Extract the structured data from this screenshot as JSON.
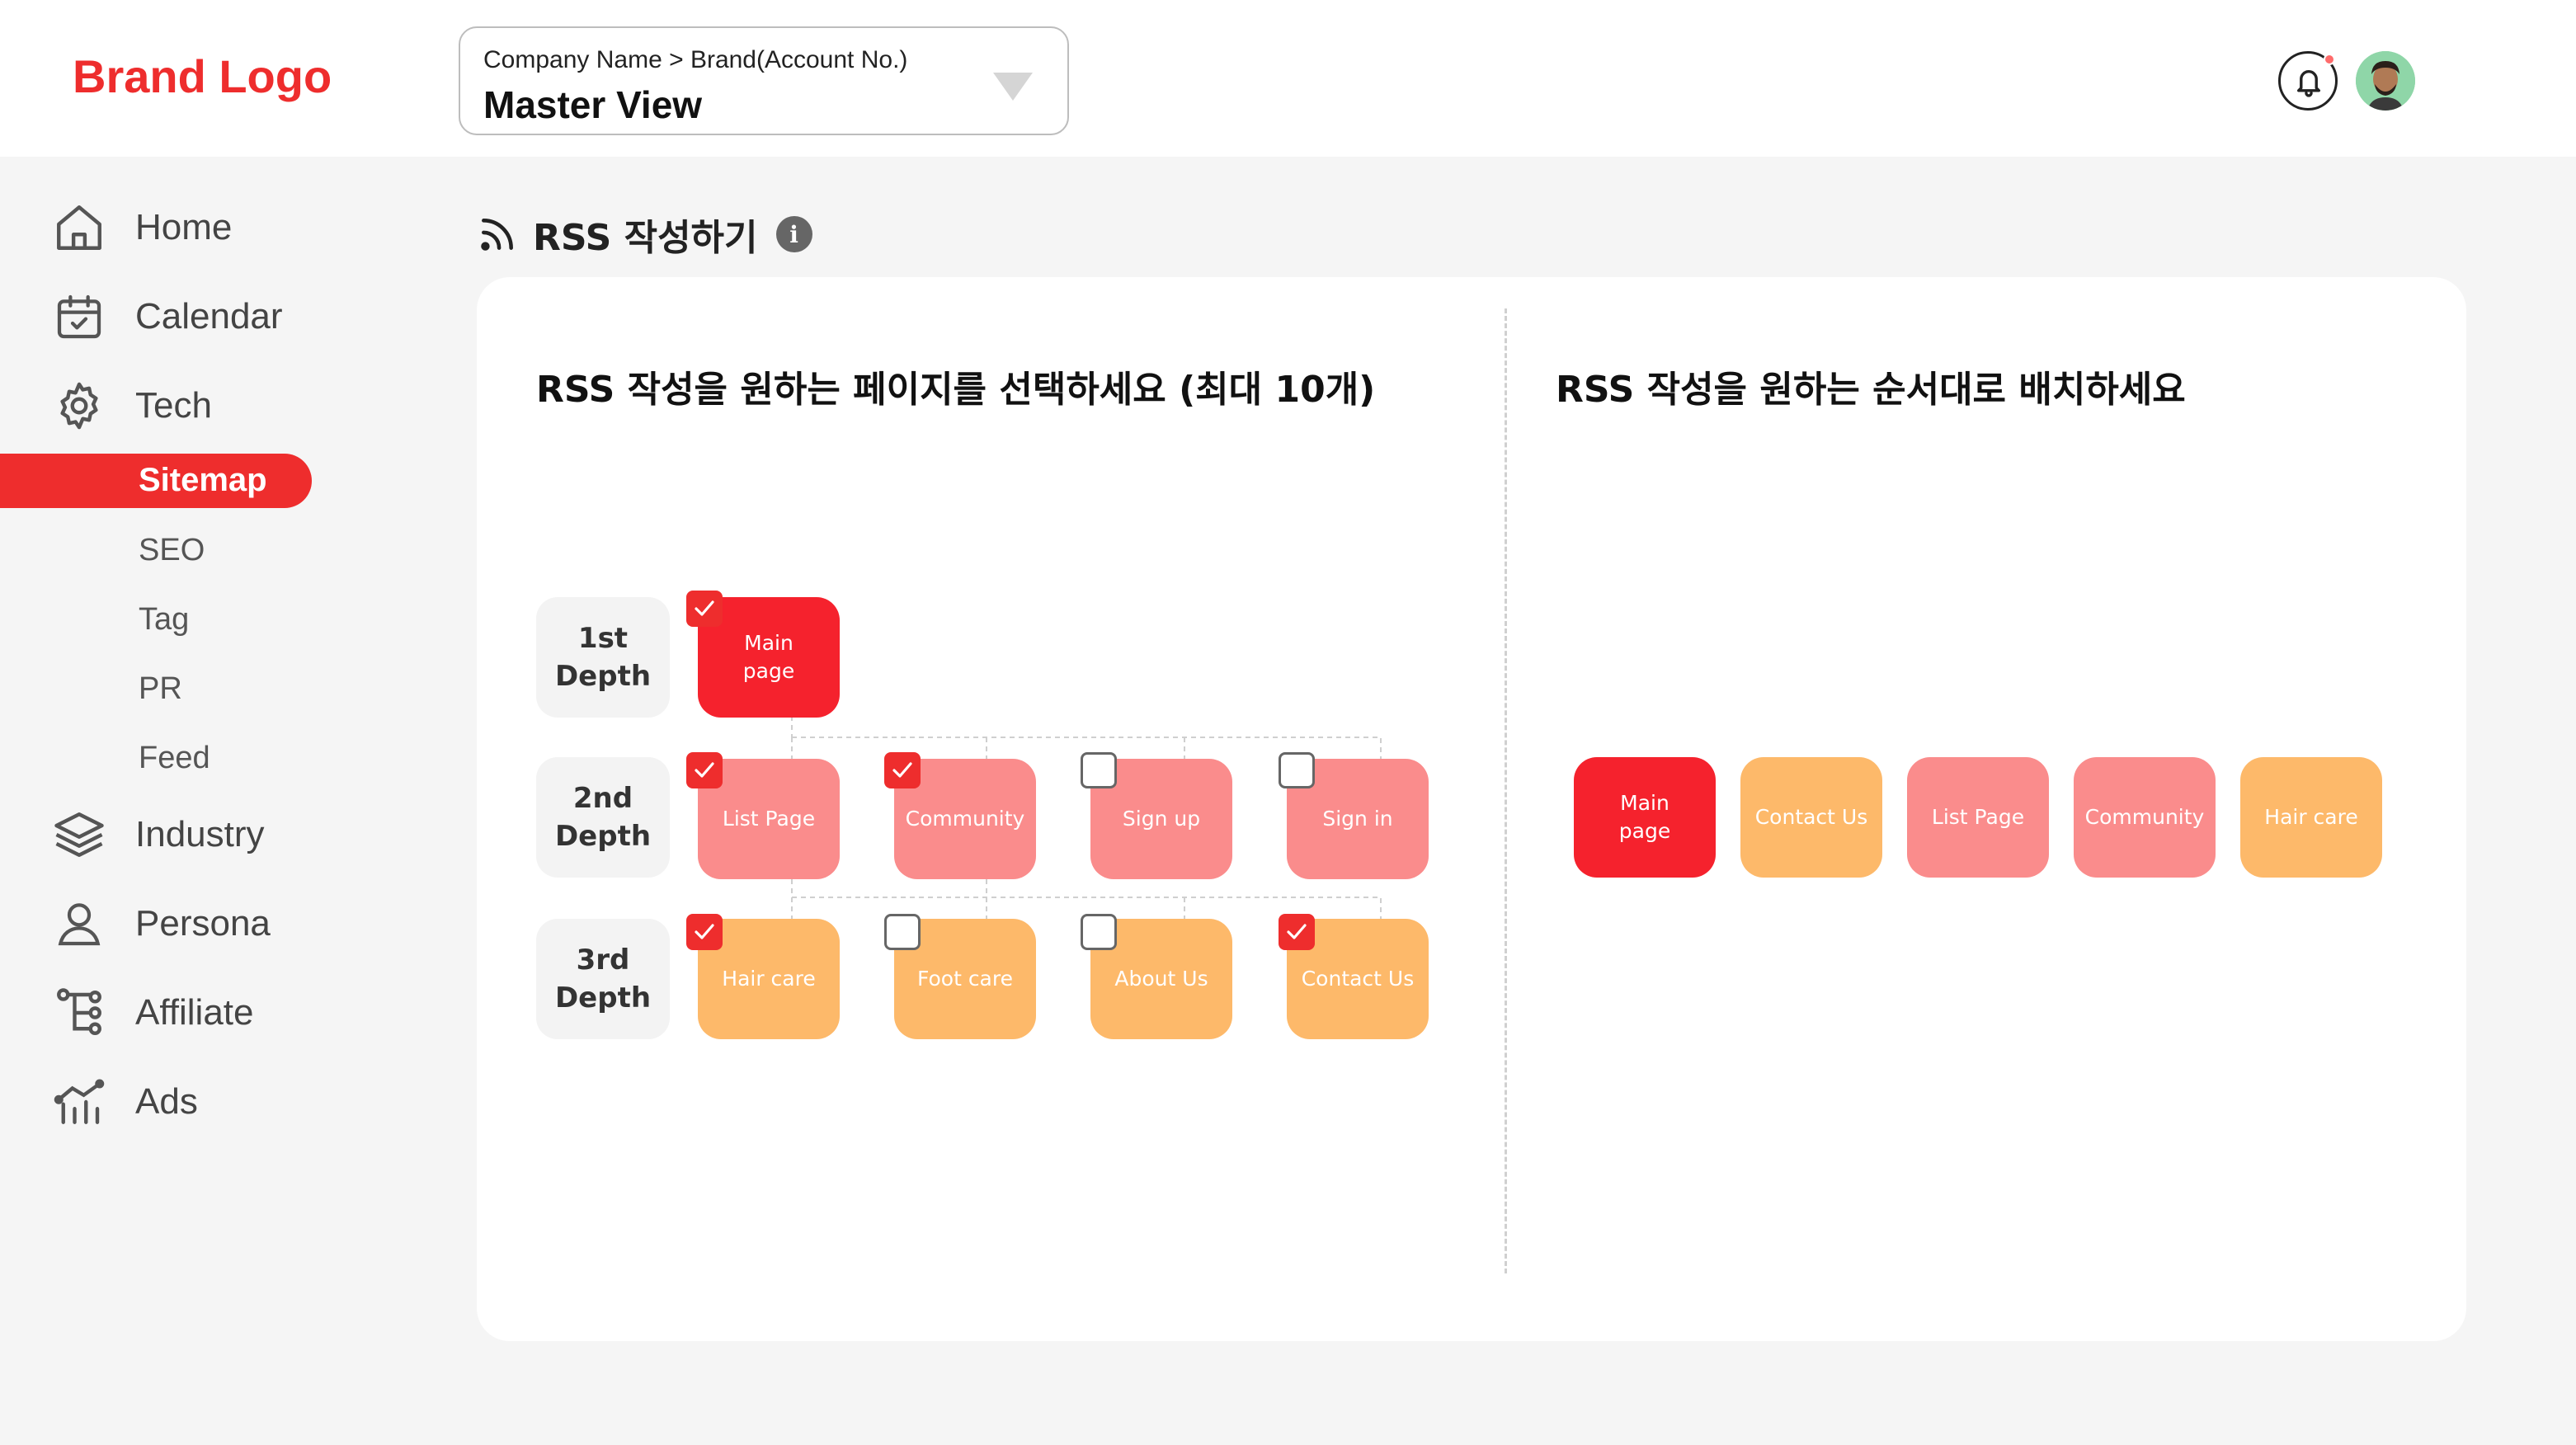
{
  "header": {
    "brand": "Brand Logo",
    "account_path": "Company Name > Brand(Account No.)",
    "account_view": "Master View"
  },
  "sidebar": {
    "items": [
      {
        "label": "Home",
        "icon": "home-icon"
      },
      {
        "label": "Calendar",
        "icon": "calendar-icon"
      },
      {
        "label": "Tech",
        "icon": "gear-icon"
      },
      {
        "label": "Industry",
        "icon": "layers-icon"
      },
      {
        "label": "Persona",
        "icon": "user-icon"
      },
      {
        "label": "Affiliate",
        "icon": "tree-icon"
      },
      {
        "label": "Ads",
        "icon": "chart-icon"
      }
    ],
    "tech_sub": [
      "Sitemap",
      "SEO",
      "Tag",
      "PR",
      "Feed"
    ],
    "active_sub": "Sitemap"
  },
  "page": {
    "title": "RSS 작성하기",
    "info": "i"
  },
  "left_panel": {
    "title": "RSS 작성을 원하는 페이지를 선택하세요 (최대 10개)",
    "depths": [
      {
        "line1": "1st",
        "line2": "Depth"
      },
      {
        "line1": "2nd",
        "line2": "Depth"
      },
      {
        "line1": "3rd",
        "line2": "Depth"
      }
    ],
    "nodes": {
      "depth1": [
        {
          "label1": "Main",
          "label2": "page",
          "checked": true
        }
      ],
      "depth2": [
        {
          "label": "List Page",
          "checked": true
        },
        {
          "label": "Community",
          "checked": true
        },
        {
          "label": "Sign up",
          "checked": false
        },
        {
          "label": "Sign in",
          "checked": false
        }
      ],
      "depth3": [
        {
          "label": "Hair care",
          "checked": true
        },
        {
          "label": "Foot care",
          "checked": false
        },
        {
          "label": "About Us",
          "checked": false
        },
        {
          "label": "Contact Us",
          "checked": true
        }
      ]
    }
  },
  "right_panel": {
    "title": "RSS 작성을 원하는 순서대로 배치하세요",
    "order": [
      {
        "label1": "Main",
        "label2": "page"
      },
      {
        "label": "Contact Us"
      },
      {
        "label": "List Page"
      },
      {
        "label": "Community"
      },
      {
        "label": "Hair care"
      }
    ]
  },
  "colors": {
    "accent": "#ee2d2d",
    "depth1": "#f5222d",
    "depth2": "#fa8c8c",
    "depth3": "#fdb96a"
  }
}
